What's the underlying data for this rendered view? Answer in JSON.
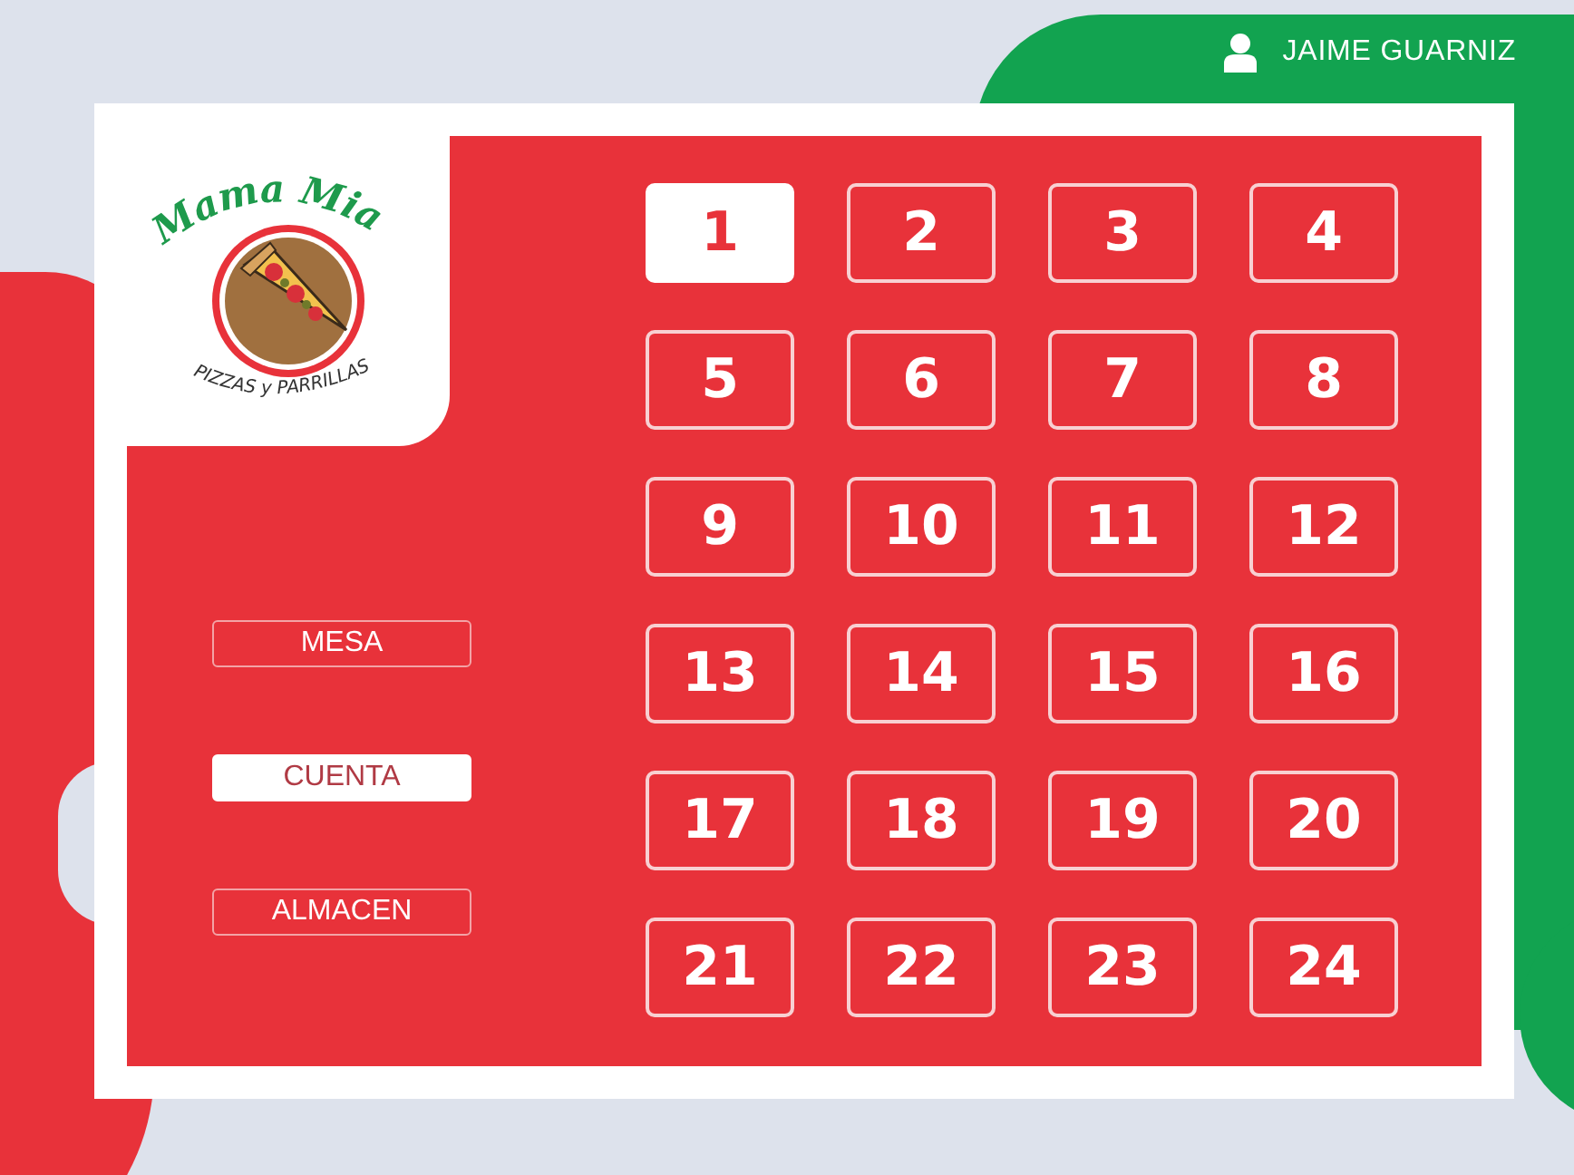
{
  "user": {
    "name": "JAIME GUARNIZ"
  },
  "logo": {
    "title": "Mama Mia",
    "subtitle": "PIZZAS y PARRILLAS"
  },
  "menu": [
    {
      "label": "MESA",
      "selected": false
    },
    {
      "label": "CUENTA",
      "selected": true
    },
    {
      "label": "ALMACEN",
      "selected": false
    }
  ],
  "tables": [
    {
      "label": "1",
      "selected": true
    },
    {
      "label": "2",
      "selected": false
    },
    {
      "label": "3",
      "selected": false
    },
    {
      "label": "4",
      "selected": false
    },
    {
      "label": "5",
      "selected": false
    },
    {
      "label": "6",
      "selected": false
    },
    {
      "label": "7",
      "selected": false
    },
    {
      "label": "8",
      "selected": false
    },
    {
      "label": "9",
      "selected": false
    },
    {
      "label": "10",
      "selected": false
    },
    {
      "label": "11",
      "selected": false
    },
    {
      "label": "12",
      "selected": false
    },
    {
      "label": "13",
      "selected": false
    },
    {
      "label": "14",
      "selected": false
    },
    {
      "label": "15",
      "selected": false
    },
    {
      "label": "16",
      "selected": false
    },
    {
      "label": "17",
      "selected": false
    },
    {
      "label": "18",
      "selected": false
    },
    {
      "label": "19",
      "selected": false
    },
    {
      "label": "20",
      "selected": false
    },
    {
      "label": "21",
      "selected": false
    },
    {
      "label": "22",
      "selected": false
    },
    {
      "label": "23",
      "selected": false
    },
    {
      "label": "24",
      "selected": false
    }
  ]
}
